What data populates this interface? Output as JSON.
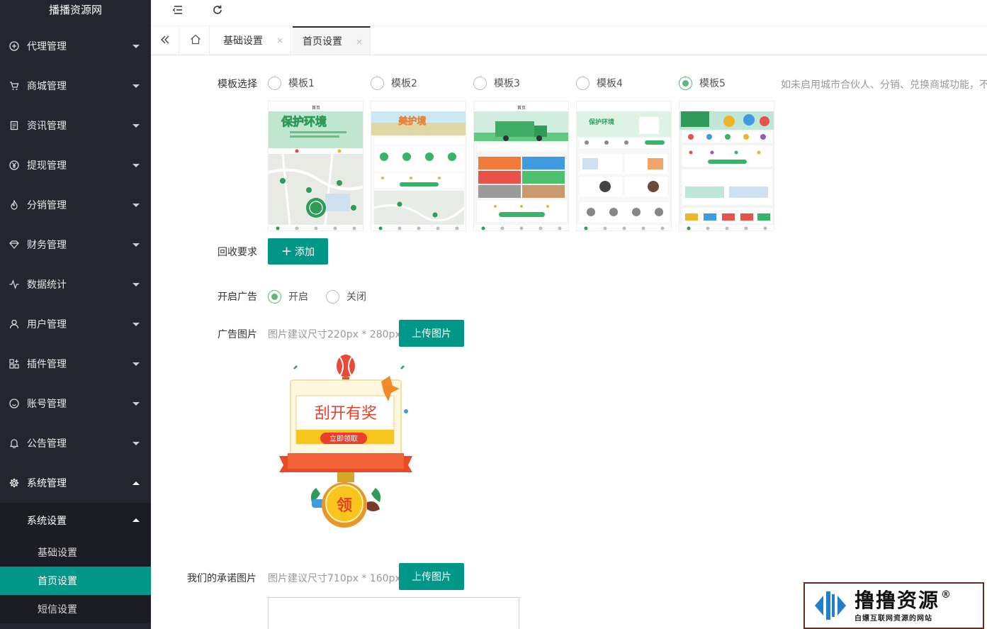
{
  "sidebar": {
    "logo": "播播资源网",
    "menu": [
      {
        "label": "代理管理",
        "icon": "plus-circle-icon"
      },
      {
        "label": "商城管理",
        "icon": "cart-icon"
      },
      {
        "label": "资讯管理",
        "icon": "document-icon"
      },
      {
        "label": "提现管理",
        "icon": "yen-icon"
      },
      {
        "label": "分销管理",
        "icon": "fire-icon"
      },
      {
        "label": "财务管理",
        "icon": "diamond-icon"
      },
      {
        "label": "数据统计",
        "icon": "pulse-icon"
      },
      {
        "label": "用户管理",
        "icon": "user-icon"
      },
      {
        "label": "插件管理",
        "icon": "apps-icon"
      },
      {
        "label": "账号管理",
        "icon": "smile-icon"
      },
      {
        "label": "公告管理",
        "icon": "bell-icon"
      },
      {
        "label": "系统管理",
        "icon": "gear-icon"
      }
    ],
    "sub_group": "系统设置",
    "leaves": [
      "基础设置",
      "首页设置",
      "短信设置"
    ]
  },
  "tabs": [
    {
      "label": "基础设置",
      "close": "×"
    },
    {
      "label": "首页设置",
      "close": "×"
    }
  ],
  "form": {
    "template_label": "模板选择",
    "templates": [
      "模板1",
      "模板2",
      "模板3",
      "模板4",
      "模板5"
    ],
    "template_selected": "模板5",
    "template_hint": "如未启用城市合伙人、分销、兑换商城功能，不",
    "recycle_label": "回收要求",
    "add_button": "添加",
    "ad_label": "开启广告",
    "ad_on": "开启",
    "ad_off": "关闭",
    "ad_selected": "开启",
    "ad_image_label": "广告图片",
    "ad_image_hint": "图片建议尺寸220px * 280px",
    "upload_button": "上传图片",
    "promise_label": "我们的承诺图片",
    "promise_hint": "图片建议尺寸710px * 160px",
    "upload_button2": "上传图片"
  },
  "ad_image": {
    "title": "刮开有奖",
    "button": "立即领取",
    "coin": "领"
  },
  "template_previews": {
    "t1": {
      "status": "首页",
      "banner": "保护环境"
    },
    "t2": {
      "banner": "美护境"
    },
    "t3": {
      "status": "首页"
    },
    "t4": {
      "banner": "保护环境"
    },
    "t5": {
      "banner": ""
    }
  },
  "watermark": {
    "title": "撸撸资源",
    "reg": "®",
    "subtitle": "白嫖互联网资源的网站"
  },
  "colors": {
    "sidebar_bg": "#23262e",
    "accent": "#009688",
    "radio_checked": "#5fb878"
  }
}
